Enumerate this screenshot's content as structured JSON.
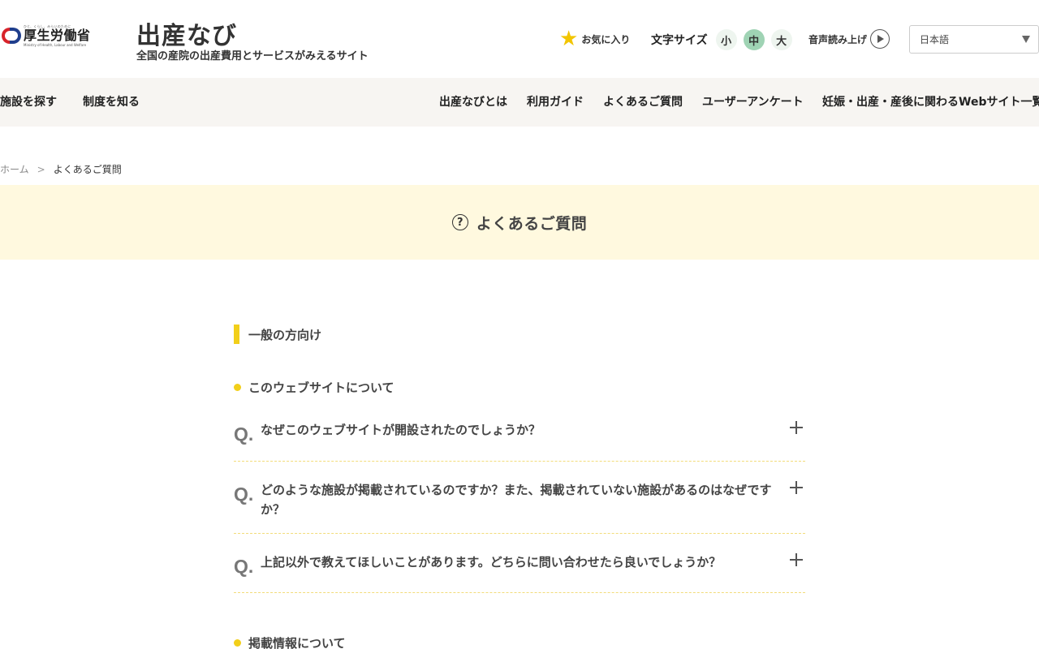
{
  "header": {
    "mhlw_tagline": "ひと、くらし、みらいのために",
    "mhlw_name": "厚生労働省",
    "mhlw_en": "Ministry of Health, Labour and Welfare",
    "site_title": "出産なび",
    "site_subtitle": "全国の産院の出産費用とサービスがみえるサイト",
    "favorite_label": "お気に入り",
    "text_size_label": "文字サイズ",
    "text_size_options": [
      "小",
      "中",
      "大"
    ],
    "text_size_selected": "中",
    "voice_label": "音声読み上げ",
    "language_selected": "日本語"
  },
  "nav": {
    "left": [
      "施設を探す",
      "制度を知る"
    ],
    "right": [
      "出産なびとは",
      "利用ガイド",
      "よくあるご質問",
      "ユーザーアンケート",
      "妊娠・出産・産後に関わるWebサイト一覧"
    ]
  },
  "breadcrumb": {
    "home": "ホーム",
    "separator": ">",
    "current": "よくあるご質問"
  },
  "hero": {
    "title": "よくあるご質問"
  },
  "faq": {
    "section_title": "一般の方向け",
    "groups": [
      {
        "title": "このウェブサイトについて",
        "questions": [
          "なぜこのウェブサイトが開設されたのでしょうか？",
          "どのような施設が掲載されているのですか？また、掲載されていない施設があるのはなぜですか？",
          "上記以外で教えてほしいことがあります。どちらに問い合わせたら良いでしょうか？"
        ]
      },
      {
        "title": "掲載情報について",
        "questions": []
      }
    ],
    "q_marker": "Q."
  },
  "colors": {
    "accent_yellow": "#f2cf1a",
    "hero_bg": "#fff9df",
    "nav_bg": "#f7f5f2",
    "text_size_active": "#9fd3b4"
  }
}
